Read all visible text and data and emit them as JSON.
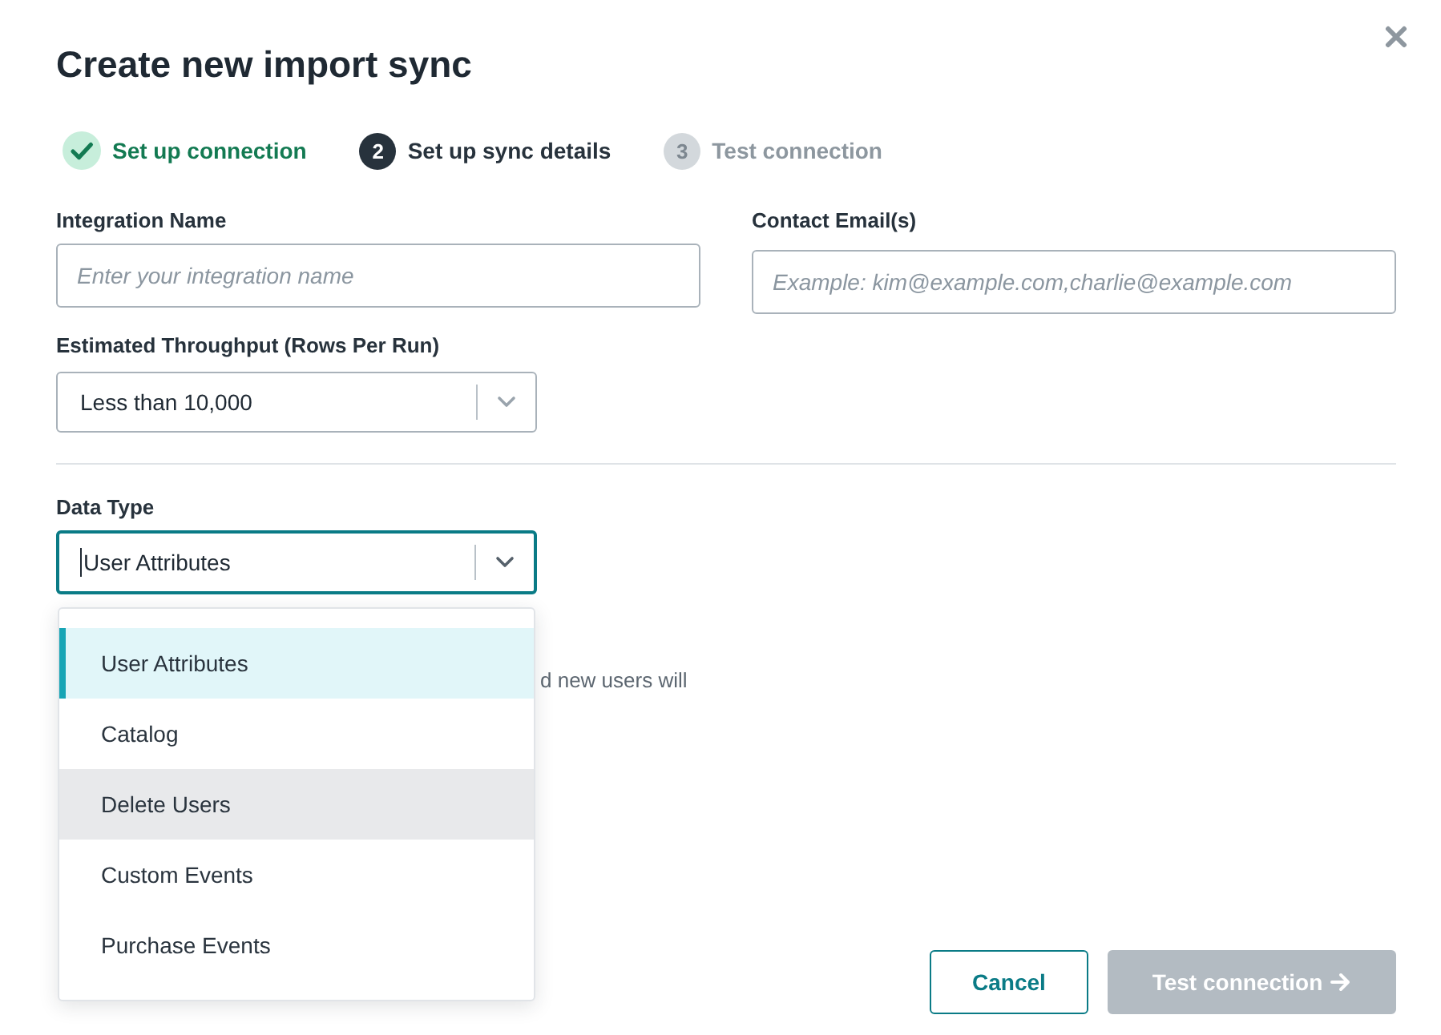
{
  "dialog": {
    "title": "Create new import sync"
  },
  "steps": [
    {
      "label": "Set up connection",
      "completed": true,
      "current": false
    },
    {
      "number": "2",
      "label": "Set up sync details",
      "completed": false,
      "current": true
    },
    {
      "number": "3",
      "label": "Test connection",
      "completed": false,
      "current": false
    }
  ],
  "fields": [
    {
      "kind": "text",
      "label": "Integration Name",
      "placeholder": "Enter your integration name"
    },
    {
      "kind": "text",
      "label": "Contact Email(s)",
      "placeholder": "Example: kim@example.com,charlie@example.com"
    },
    {
      "kind": "select",
      "label": "Estimated Throughput (Rows Per Run)",
      "value": "Less than 10,000",
      "focused": false
    }
  ],
  "data_type": {
    "kind": "select",
    "label": "Data Type",
    "value": "User Attributes",
    "focused": true,
    "help_text": "d new users will",
    "options": [
      {
        "label": "User Attributes",
        "selected": true,
        "hovered": false
      },
      {
        "label": "Catalog",
        "selected": false,
        "hovered": false
      },
      {
        "label": "Delete Users",
        "selected": false,
        "hovered": true
      },
      {
        "label": "Custom Events",
        "selected": false,
        "hovered": false
      },
      {
        "label": "Purchase Events",
        "selected": false,
        "hovered": false
      }
    ]
  },
  "buttons": [
    {
      "label": "Cancel",
      "kind": "secondary",
      "disabled": false
    },
    {
      "label": "Test connection",
      "kind": "primary",
      "disabled": true
    }
  ]
}
